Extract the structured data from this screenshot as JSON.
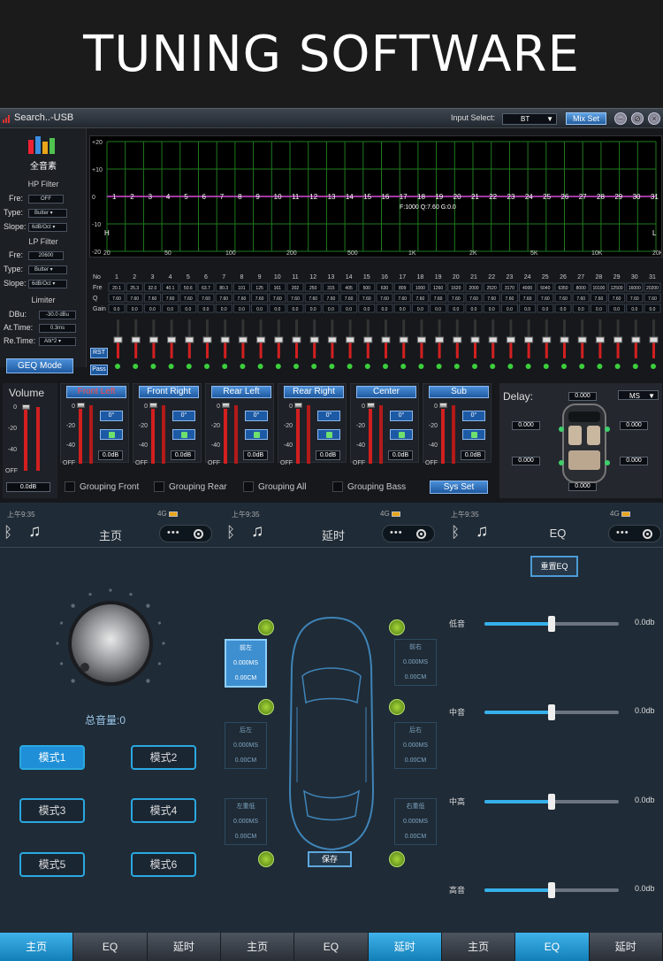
{
  "banner": {
    "title": "TUNING SOFTWARE"
  },
  "desktop": {
    "window_title": "Search..-USB",
    "input_select_label": "Input Select:",
    "input_select_value": "BT",
    "mix_set_label": "Mix Set",
    "logo_text": "全音素",
    "hp_filter": {
      "title": "HP Filter",
      "fre_label": "Fre:",
      "fre_value": "OFF",
      "type_label": "Type:",
      "type_value": "Butter",
      "slope_label": "Slope:",
      "slope_value": "6dB/Oct"
    },
    "lp_filter": {
      "title": "LP Filter",
      "fre_label": "Fre:",
      "fre_value": "20600",
      "type_label": "Type:",
      "type_value": "Butter",
      "slope_label": "Slope:",
      "slope_value": "6dB/Oct"
    },
    "limiter": {
      "title": "Limiter",
      "dbu_label": "DBu:",
      "dbu_value": "-30.0 dBu",
      "attime_label": "At.Time:",
      "attime_value": "0.3ms",
      "retime_label": "Re.Time:",
      "retime_value": "Atk*2"
    },
    "geq_mode_label": "GEQ Mode",
    "graph": {
      "y_ticks": [
        "+20",
        "+10",
        "0",
        "-10",
        "-20"
      ],
      "x_ticks": [
        "20",
        "50",
        "100",
        "200",
        "500",
        "1K",
        "2K",
        "5K",
        "10K",
        "20KHz"
      ],
      "band_numbers": [
        "1",
        "2",
        "3",
        "4",
        "5",
        "6",
        "7",
        "8",
        "9",
        "10",
        "11",
        "12",
        "13",
        "14",
        "15",
        "16",
        "17",
        "18",
        "19",
        "20",
        "21",
        "22",
        "23",
        "24",
        "25",
        "26",
        "27",
        "28",
        "29",
        "30",
        "31"
      ],
      "readout": "F:1000 Q:7.60 G:0.0",
      "h_label": "H",
      "l_label": "L"
    },
    "table": {
      "row_labels": [
        "No",
        "Fre",
        "Q",
        "Gain"
      ],
      "freqs": [
        "20.1",
        "25.3",
        "32.0",
        "40.1",
        "50.6",
        "63.7",
        "80.3",
        "101",
        "125",
        "161",
        "202",
        "250",
        "315",
        "405",
        "500",
        "630",
        "809",
        "1000",
        "1260",
        "1620",
        "2000",
        "2520",
        "3170",
        "4000",
        "5040",
        "6350",
        "8000",
        "10100",
        "12500",
        "16000",
        "20200"
      ],
      "q": "7.60",
      "gain": "0.0"
    },
    "rst_label": "RST",
    "pass_label": "Pass",
    "volume": {
      "title": "Volume",
      "value": "0.0dB"
    },
    "meter_scale": [
      "0",
      "-20",
      "-40",
      "OFF"
    ],
    "channels": [
      {
        "name": "Front Left",
        "phase": "0°",
        "db": "0.0dB"
      },
      {
        "name": "Front Right",
        "phase": "0°",
        "db": "0.0dB"
      },
      {
        "name": "Rear Left",
        "phase": "0°",
        "db": "0.0dB"
      },
      {
        "name": "Rear Right",
        "phase": "0°",
        "db": "0.0dB"
      },
      {
        "name": "Center",
        "phase": "0°",
        "db": "0.0dB"
      },
      {
        "name": "Sub",
        "phase": "0°",
        "db": "0.0dB"
      }
    ],
    "grouping": [
      "Grouping Front",
      "Grouping Rear",
      "Grouping All",
      "Grouping Bass"
    ],
    "sys_set_label": "Sys Set",
    "delay": {
      "title": "Delay:",
      "unit": "MS",
      "values": [
        "0.000",
        "0.000",
        "0.000",
        "0.000",
        "0.000",
        "0.000"
      ]
    }
  },
  "phones": {
    "status_time": "上午9:35",
    "status_net": "4G",
    "screens": [
      {
        "title": "主页"
      },
      {
        "title": "延时"
      },
      {
        "title": "EQ"
      }
    ],
    "main": {
      "total_volume": "总音量:0",
      "modes": [
        "模式1",
        "模式2",
        "模式3",
        "模式4",
        "模式5",
        "模式6"
      ]
    },
    "delay": {
      "boxes": [
        {
          "name": "前左",
          "ms": "0.000MS",
          "cm": "0.00CM"
        },
        {
          "name": "前右",
          "ms": "0.000MS",
          "cm": "0.00CM"
        },
        {
          "name": "后左",
          "ms": "0.000MS",
          "cm": "0.00CM"
        },
        {
          "name": "后右",
          "ms": "0.000MS",
          "cm": "0.00CM"
        },
        {
          "name": "左重低",
          "ms": "0.000MS",
          "cm": "0.00CM"
        },
        {
          "name": "右重低",
          "ms": "0.000MS",
          "cm": "0.00CM"
        }
      ],
      "save_label": "保存"
    },
    "eq": {
      "reset_label": "重置EQ",
      "bands": [
        {
          "name": "低音",
          "value": "0.0db",
          "level": 0.5
        },
        {
          "name": "中音",
          "value": "0.0db",
          "level": 0.5
        },
        {
          "name": "中高",
          "value": "0.0db",
          "level": 0.5
        },
        {
          "name": "高音",
          "value": "0.0db",
          "level": 0.5
        }
      ]
    },
    "tabs": [
      {
        "label": "主页",
        "active": true
      },
      {
        "label": "EQ",
        "active": false
      },
      {
        "label": "延时",
        "active": false
      },
      {
        "label": "主页",
        "active": false
      },
      {
        "label": "EQ",
        "active": false
      },
      {
        "label": "延时",
        "active": true
      },
      {
        "label": "主页",
        "active": false
      },
      {
        "label": "EQ",
        "active": true
      },
      {
        "label": "延时",
        "active": false
      }
    ]
  }
}
